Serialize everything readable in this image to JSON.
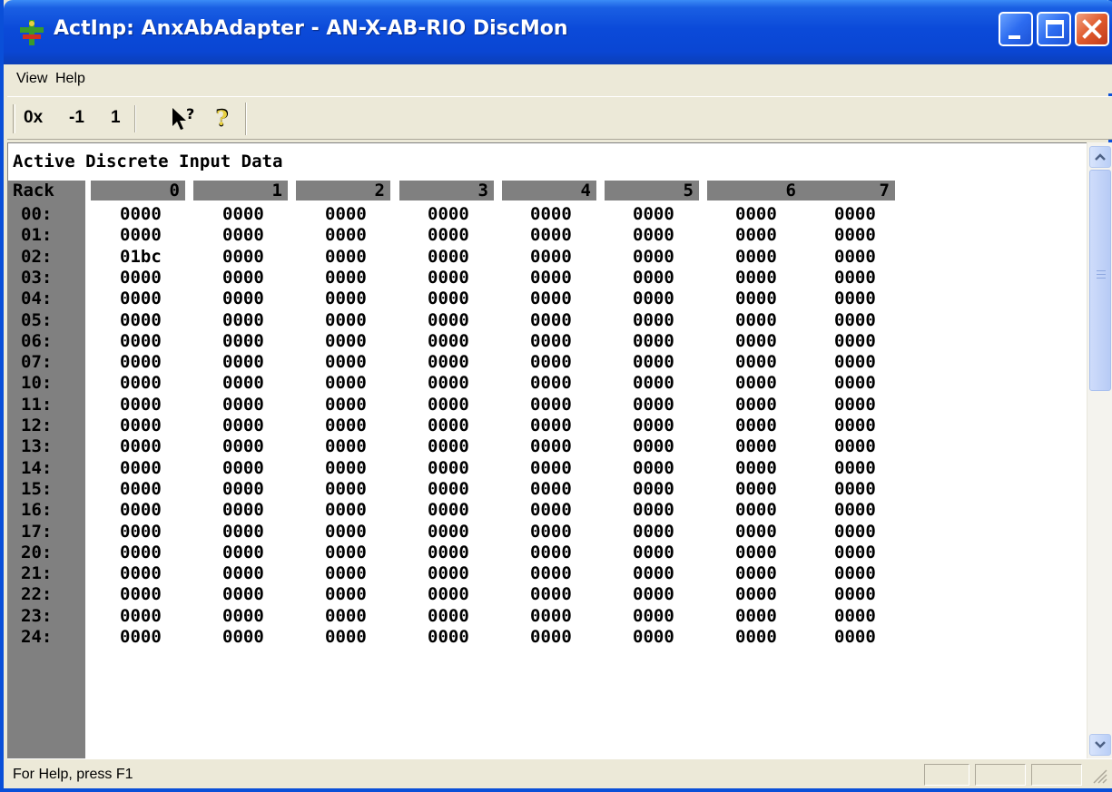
{
  "window": {
    "title": "ActInp: AnxAbAdapter - AN-X-AB-RIO DiscMon",
    "title_icon": "network-app-icon"
  },
  "menu": {
    "view": "View",
    "help": "Help"
  },
  "toolbar": {
    "hex_label": "0x",
    "minus_one_label": "-1",
    "one_label": "1",
    "context_help_icon": "context-help-icon",
    "help_icon": "help-icon"
  },
  "content": {
    "heading": "Active Discrete Input Data",
    "rack_header": "Rack",
    "columns": [
      "0",
      "1",
      "2",
      "3",
      "4",
      "5",
      "6",
      "7"
    ],
    "rows": [
      {
        "label": "00:",
        "values": [
          "0000",
          "0000",
          "0000",
          "0000",
          "0000",
          "0000",
          "0000",
          "0000"
        ]
      },
      {
        "label": "01:",
        "values": [
          "0000",
          "0000",
          "0000",
          "0000",
          "0000",
          "0000",
          "0000",
          "0000"
        ]
      },
      {
        "label": "02:",
        "values": [
          "01bc",
          "0000",
          "0000",
          "0000",
          "0000",
          "0000",
          "0000",
          "0000"
        ]
      },
      {
        "label": "03:",
        "values": [
          "0000",
          "0000",
          "0000",
          "0000",
          "0000",
          "0000",
          "0000",
          "0000"
        ]
      },
      {
        "label": "04:",
        "values": [
          "0000",
          "0000",
          "0000",
          "0000",
          "0000",
          "0000",
          "0000",
          "0000"
        ]
      },
      {
        "label": "05:",
        "values": [
          "0000",
          "0000",
          "0000",
          "0000",
          "0000",
          "0000",
          "0000",
          "0000"
        ]
      },
      {
        "label": "06:",
        "values": [
          "0000",
          "0000",
          "0000",
          "0000",
          "0000",
          "0000",
          "0000",
          "0000"
        ]
      },
      {
        "label": "07:",
        "values": [
          "0000",
          "0000",
          "0000",
          "0000",
          "0000",
          "0000",
          "0000",
          "0000"
        ]
      },
      {
        "label": "10:",
        "values": [
          "0000",
          "0000",
          "0000",
          "0000",
          "0000",
          "0000",
          "0000",
          "0000"
        ]
      },
      {
        "label": "11:",
        "values": [
          "0000",
          "0000",
          "0000",
          "0000",
          "0000",
          "0000",
          "0000",
          "0000"
        ]
      },
      {
        "label": "12:",
        "values": [
          "0000",
          "0000",
          "0000",
          "0000",
          "0000",
          "0000",
          "0000",
          "0000"
        ]
      },
      {
        "label": "13:",
        "values": [
          "0000",
          "0000",
          "0000",
          "0000",
          "0000",
          "0000",
          "0000",
          "0000"
        ]
      },
      {
        "label": "14:",
        "values": [
          "0000",
          "0000",
          "0000",
          "0000",
          "0000",
          "0000",
          "0000",
          "0000"
        ]
      },
      {
        "label": "15:",
        "values": [
          "0000",
          "0000",
          "0000",
          "0000",
          "0000",
          "0000",
          "0000",
          "0000"
        ]
      },
      {
        "label": "16:",
        "values": [
          "0000",
          "0000",
          "0000",
          "0000",
          "0000",
          "0000",
          "0000",
          "0000"
        ]
      },
      {
        "label": "17:",
        "values": [
          "0000",
          "0000",
          "0000",
          "0000",
          "0000",
          "0000",
          "0000",
          "0000"
        ]
      },
      {
        "label": "20:",
        "values": [
          "0000",
          "0000",
          "0000",
          "0000",
          "0000",
          "0000",
          "0000",
          "0000"
        ]
      },
      {
        "label": "21:",
        "values": [
          "0000",
          "0000",
          "0000",
          "0000",
          "0000",
          "0000",
          "0000",
          "0000"
        ]
      },
      {
        "label": "22:",
        "values": [
          "0000",
          "0000",
          "0000",
          "0000",
          "0000",
          "0000",
          "0000",
          "0000"
        ]
      },
      {
        "label": "23:",
        "values": [
          "0000",
          "0000",
          "0000",
          "0000",
          "0000",
          "0000",
          "0000",
          "0000"
        ]
      },
      {
        "label": "24:",
        "values": [
          "0000",
          "0000",
          "0000",
          "0000",
          "0000",
          "0000",
          "0000",
          "0000"
        ]
      }
    ]
  },
  "status": {
    "text": "For Help, press F1"
  },
  "colors": {
    "titlebar": "#0a46d3",
    "header_gray": "#808080",
    "window_bg": "#ece9d8"
  }
}
